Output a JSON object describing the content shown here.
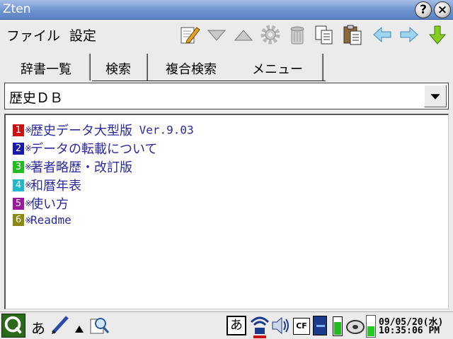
{
  "window": {
    "title": "Zten",
    "help_label": "?",
    "close_label": "×"
  },
  "menu": {
    "file": "ファイル",
    "settings": "設定"
  },
  "toolbar": {
    "icons": [
      "edit-icon",
      "scroll-down-icon",
      "scroll-up-icon",
      "gear-icon",
      "trash-icon",
      "copy-icon",
      "paste-icon",
      "back-icon",
      "forward-icon",
      "download-icon"
    ]
  },
  "tabs": [
    {
      "label": "辞書一覧",
      "active": false
    },
    {
      "label": "検索",
      "active": false
    },
    {
      "label": "複合検索",
      "active": false
    },
    {
      "label": "メニュー",
      "active": true
    }
  ],
  "dictionary": {
    "selected": "歴史ＤＢ"
  },
  "results": [
    {
      "num": "1",
      "color": "#cc1111",
      "text": "歴史データ大型版",
      "version": " Ver.9.03"
    },
    {
      "num": "2",
      "color": "#1a1aa8",
      "text": "データの転載について"
    },
    {
      "num": "3",
      "color": "#22bb22",
      "text": "著者略歴・改訂版"
    },
    {
      "num": "4",
      "color": "#22b8c8",
      "text": "和暦年表"
    },
    {
      "num": "5",
      "color": "#9a1a9a",
      "text": "使い方"
    },
    {
      "num": "6",
      "color": "#8a8a10",
      "text": "Readme"
    }
  ],
  "result_mark": "※",
  "taskbar": {
    "input_mode": "あ",
    "ime_label": "あ",
    "cf_label": "CF",
    "date": "09/05/20(水)",
    "time": "10:35:06 PM",
    "accent": "#5a82c4"
  }
}
